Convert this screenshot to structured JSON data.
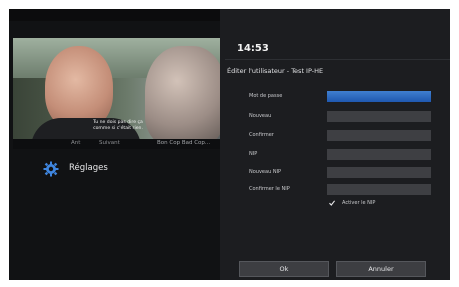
{
  "video": {
    "subtitle": "Tu ne dois pas dire ça\ncomme si c'était rien.",
    "info_left": "Ant",
    "info_mid": "Suivant",
    "info_right": "Bon Cop Bad Cop..."
  },
  "sidebar": {
    "settings_label": "Réglages",
    "settings_icon": "gear-icon"
  },
  "header": {
    "clock": "14:53"
  },
  "form": {
    "title": "Éditer l'utilisateur - Test IP-HE",
    "fields": [
      {
        "label": "Mot de passe",
        "value": ""
      },
      {
        "label": "Nouveau",
        "value": ""
      },
      {
        "label": "Confirmer",
        "value": ""
      },
      {
        "label": "NIP",
        "value": ""
      },
      {
        "label": "Nouveau NIP",
        "value": ""
      },
      {
        "label": "Confirmer le NIP",
        "value": ""
      }
    ],
    "checkbox_label": "Activer le NIP",
    "checkbox_checked": true
  },
  "buttons": {
    "ok_label": "Ok",
    "cancel_label": "Annuler"
  },
  "colors": {
    "accent": "#2a66c0",
    "background": "#111214",
    "field": "#3e3f43"
  }
}
